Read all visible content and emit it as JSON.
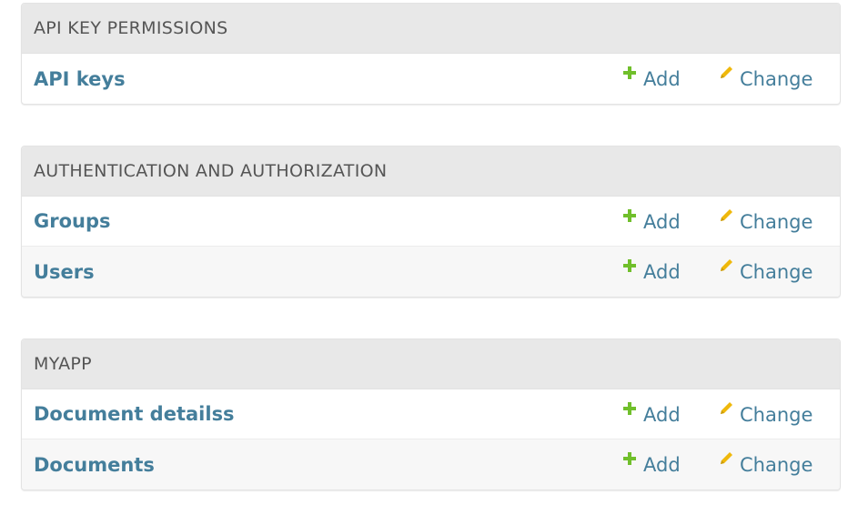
{
  "modules": [
    {
      "title": "API KEY PERMISSIONS",
      "rows": [
        {
          "name": "API keys",
          "add_label": "Add",
          "change_label": "Change"
        }
      ]
    },
    {
      "title": "AUTHENTICATION AND AUTHORIZATION",
      "rows": [
        {
          "name": "Groups",
          "add_label": "Add",
          "change_label": "Change"
        },
        {
          "name": "Users",
          "add_label": "Add",
          "change_label": "Change"
        }
      ]
    },
    {
      "title": "MYAPP",
      "rows": [
        {
          "name": "Document detailss",
          "add_label": "Add",
          "change_label": "Change"
        },
        {
          "name": "Documents",
          "add_label": "Add",
          "change_label": "Change"
        }
      ]
    }
  ],
  "icons": {
    "add": "plus-icon",
    "change": "pencil-icon"
  },
  "colors": {
    "link": "#447e9b",
    "header_bg": "#e8e8e8",
    "header_text": "#555555",
    "add_icon": "#70bf2b",
    "change_icon": "#efb80b"
  }
}
